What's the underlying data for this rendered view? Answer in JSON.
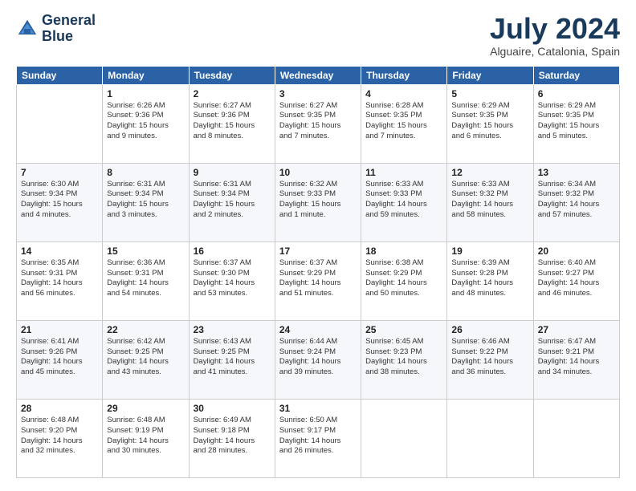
{
  "header": {
    "logo_line1": "General",
    "logo_line2": "Blue",
    "month": "July 2024",
    "location": "Alguaire, Catalonia, Spain"
  },
  "weekdays": [
    "Sunday",
    "Monday",
    "Tuesday",
    "Wednesday",
    "Thursday",
    "Friday",
    "Saturday"
  ],
  "weeks": [
    [
      {
        "day": "",
        "detail": ""
      },
      {
        "day": "1",
        "detail": "Sunrise: 6:26 AM\nSunset: 9:36 PM\nDaylight: 15 hours\nand 9 minutes."
      },
      {
        "day": "2",
        "detail": "Sunrise: 6:27 AM\nSunset: 9:36 PM\nDaylight: 15 hours\nand 8 minutes."
      },
      {
        "day": "3",
        "detail": "Sunrise: 6:27 AM\nSunset: 9:35 PM\nDaylight: 15 hours\nand 7 minutes."
      },
      {
        "day": "4",
        "detail": "Sunrise: 6:28 AM\nSunset: 9:35 PM\nDaylight: 15 hours\nand 7 minutes."
      },
      {
        "day": "5",
        "detail": "Sunrise: 6:29 AM\nSunset: 9:35 PM\nDaylight: 15 hours\nand 6 minutes."
      },
      {
        "day": "6",
        "detail": "Sunrise: 6:29 AM\nSunset: 9:35 PM\nDaylight: 15 hours\nand 5 minutes."
      }
    ],
    [
      {
        "day": "7",
        "detail": "Sunrise: 6:30 AM\nSunset: 9:34 PM\nDaylight: 15 hours\nand 4 minutes."
      },
      {
        "day": "8",
        "detail": "Sunrise: 6:31 AM\nSunset: 9:34 PM\nDaylight: 15 hours\nand 3 minutes."
      },
      {
        "day": "9",
        "detail": "Sunrise: 6:31 AM\nSunset: 9:34 PM\nDaylight: 15 hours\nand 2 minutes."
      },
      {
        "day": "10",
        "detail": "Sunrise: 6:32 AM\nSunset: 9:33 PM\nDaylight: 15 hours\nand 1 minute."
      },
      {
        "day": "11",
        "detail": "Sunrise: 6:33 AM\nSunset: 9:33 PM\nDaylight: 14 hours\nand 59 minutes."
      },
      {
        "day": "12",
        "detail": "Sunrise: 6:33 AM\nSunset: 9:32 PM\nDaylight: 14 hours\nand 58 minutes."
      },
      {
        "day": "13",
        "detail": "Sunrise: 6:34 AM\nSunset: 9:32 PM\nDaylight: 14 hours\nand 57 minutes."
      }
    ],
    [
      {
        "day": "14",
        "detail": "Sunrise: 6:35 AM\nSunset: 9:31 PM\nDaylight: 14 hours\nand 56 minutes."
      },
      {
        "day": "15",
        "detail": "Sunrise: 6:36 AM\nSunset: 9:31 PM\nDaylight: 14 hours\nand 54 minutes."
      },
      {
        "day": "16",
        "detail": "Sunrise: 6:37 AM\nSunset: 9:30 PM\nDaylight: 14 hours\nand 53 minutes."
      },
      {
        "day": "17",
        "detail": "Sunrise: 6:37 AM\nSunset: 9:29 PM\nDaylight: 14 hours\nand 51 minutes."
      },
      {
        "day": "18",
        "detail": "Sunrise: 6:38 AM\nSunset: 9:29 PM\nDaylight: 14 hours\nand 50 minutes."
      },
      {
        "day": "19",
        "detail": "Sunrise: 6:39 AM\nSunset: 9:28 PM\nDaylight: 14 hours\nand 48 minutes."
      },
      {
        "day": "20",
        "detail": "Sunrise: 6:40 AM\nSunset: 9:27 PM\nDaylight: 14 hours\nand 46 minutes."
      }
    ],
    [
      {
        "day": "21",
        "detail": "Sunrise: 6:41 AM\nSunset: 9:26 PM\nDaylight: 14 hours\nand 45 minutes."
      },
      {
        "day": "22",
        "detail": "Sunrise: 6:42 AM\nSunset: 9:25 PM\nDaylight: 14 hours\nand 43 minutes."
      },
      {
        "day": "23",
        "detail": "Sunrise: 6:43 AM\nSunset: 9:25 PM\nDaylight: 14 hours\nand 41 minutes."
      },
      {
        "day": "24",
        "detail": "Sunrise: 6:44 AM\nSunset: 9:24 PM\nDaylight: 14 hours\nand 39 minutes."
      },
      {
        "day": "25",
        "detail": "Sunrise: 6:45 AM\nSunset: 9:23 PM\nDaylight: 14 hours\nand 38 minutes."
      },
      {
        "day": "26",
        "detail": "Sunrise: 6:46 AM\nSunset: 9:22 PM\nDaylight: 14 hours\nand 36 minutes."
      },
      {
        "day": "27",
        "detail": "Sunrise: 6:47 AM\nSunset: 9:21 PM\nDaylight: 14 hours\nand 34 minutes."
      }
    ],
    [
      {
        "day": "28",
        "detail": "Sunrise: 6:48 AM\nSunset: 9:20 PM\nDaylight: 14 hours\nand 32 minutes."
      },
      {
        "day": "29",
        "detail": "Sunrise: 6:48 AM\nSunset: 9:19 PM\nDaylight: 14 hours\nand 30 minutes."
      },
      {
        "day": "30",
        "detail": "Sunrise: 6:49 AM\nSunset: 9:18 PM\nDaylight: 14 hours\nand 28 minutes."
      },
      {
        "day": "31",
        "detail": "Sunrise: 6:50 AM\nSunset: 9:17 PM\nDaylight: 14 hours\nand 26 minutes."
      },
      {
        "day": "",
        "detail": ""
      },
      {
        "day": "",
        "detail": ""
      },
      {
        "day": "",
        "detail": ""
      }
    ]
  ]
}
